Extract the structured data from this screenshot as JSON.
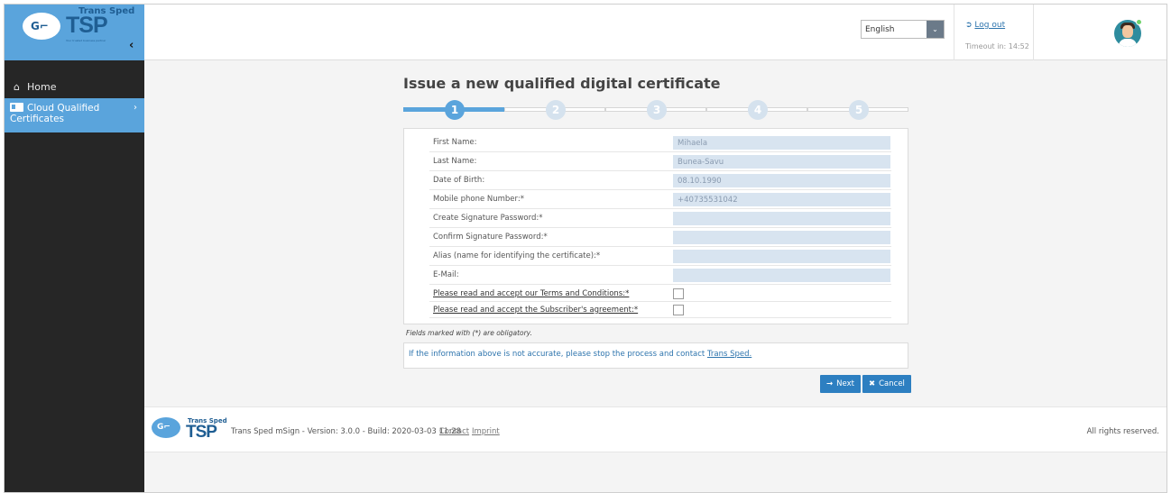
{
  "brand": {
    "logo_small": "Trans Sped",
    "logo_big": "TSP",
    "logo_tagline": "Your trusted business partner",
    "logo_key": "G⌐"
  },
  "sidebar": {
    "collapse_glyph": "‹",
    "items": [
      {
        "icon": "home-icon",
        "label": "Home"
      },
      {
        "icon": "id-card-icon",
        "label": "Cloud Qualified Certificates",
        "active": true
      }
    ]
  },
  "header": {
    "language": {
      "selected": "English"
    },
    "logout_label": "Log out",
    "timeout_text": "Timeout in: 14:52"
  },
  "main": {
    "title": "Issue a new qualified digital certificate",
    "steps": [
      {
        "label": "1",
        "active": true
      },
      {
        "label": "2",
        "active": false
      },
      {
        "label": "3",
        "active": false
      },
      {
        "label": "4",
        "active": false
      },
      {
        "label": "5",
        "active": false
      }
    ],
    "form": {
      "first_name": {
        "label": "First Name:",
        "value": "Mihaela"
      },
      "last_name": {
        "label": "Last Name:",
        "value": "Bunea-Savu"
      },
      "dob": {
        "label": "Date of Birth:",
        "value": "08.10.1990"
      },
      "mobile": {
        "label": "Mobile phone Number:*",
        "value": "+40735531042"
      },
      "create_pwd": {
        "label": "Create Signature Password:*",
        "value": ""
      },
      "confirm_pwd": {
        "label": "Confirm Signature Password:*",
        "value": ""
      },
      "alias": {
        "label": "Alias (name for identifying the certificate):*",
        "value": ""
      },
      "email": {
        "label": "E-Mail:",
        "value": ""
      },
      "terms": {
        "label": "Please read and accept our Terms and Conditions:*",
        "checked": false
      },
      "subscriber": {
        "label": "Please read and accept the Subscriber's agreement:*",
        "checked": false
      }
    },
    "note": "Fields marked with (*) are obligatory.",
    "info_text": "If the information above is not accurate, please stop the process and contact",
    "info_link": "Trans Sped.",
    "next_label": "Next",
    "cancel_label": "Cancel"
  },
  "footer": {
    "logo_small": "Trans Sped",
    "logo_big": "TSP",
    "version_text": "Trans Sped mSign - Version: 3.0.0 - Build: 2020-03-03 11:28",
    "contact_label": "Contact",
    "imprint_label": "Imprint",
    "rights": "All rights reserved."
  },
  "colors": {
    "accent": "#5aa4dc",
    "button": "#2d7fc1",
    "sidebar_bg": "#262626",
    "input_bg": "#d8e4f0"
  }
}
